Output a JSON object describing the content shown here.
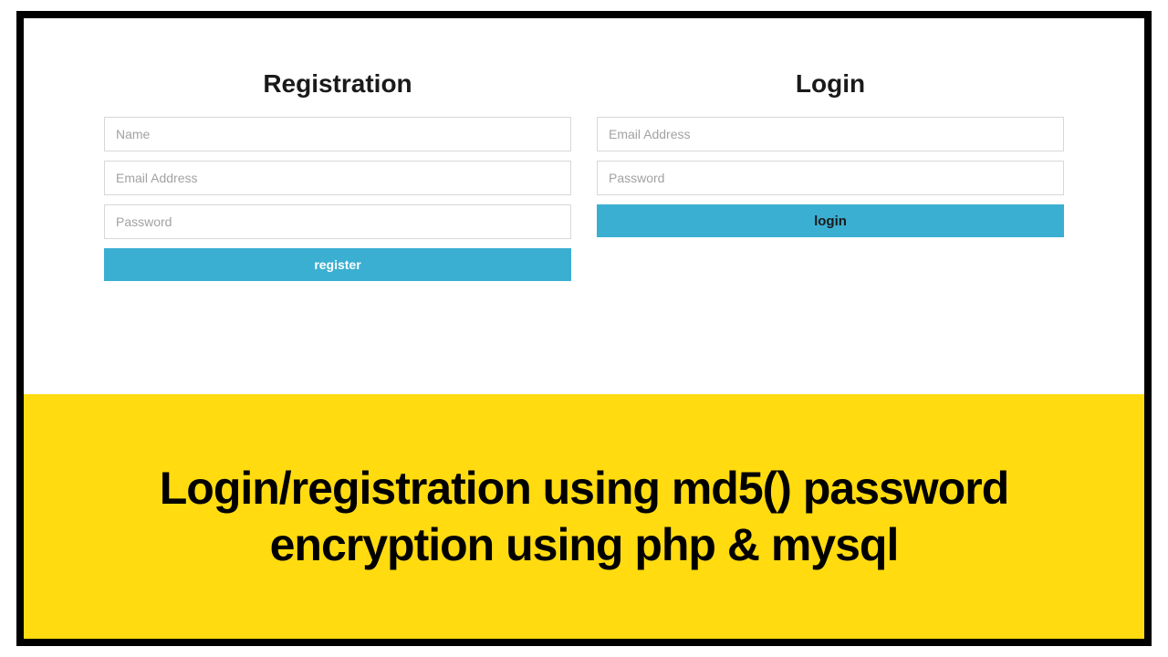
{
  "registration": {
    "heading": "Registration",
    "name_placeholder": "Name",
    "email_placeholder": "Email Address",
    "password_placeholder": "Password",
    "button_label": "register"
  },
  "login": {
    "heading": "Login",
    "email_placeholder": "Email Address",
    "password_placeholder": "Password",
    "button_label": "login"
  },
  "caption": "Login/registration using md5() password encryption using php & mysql"
}
